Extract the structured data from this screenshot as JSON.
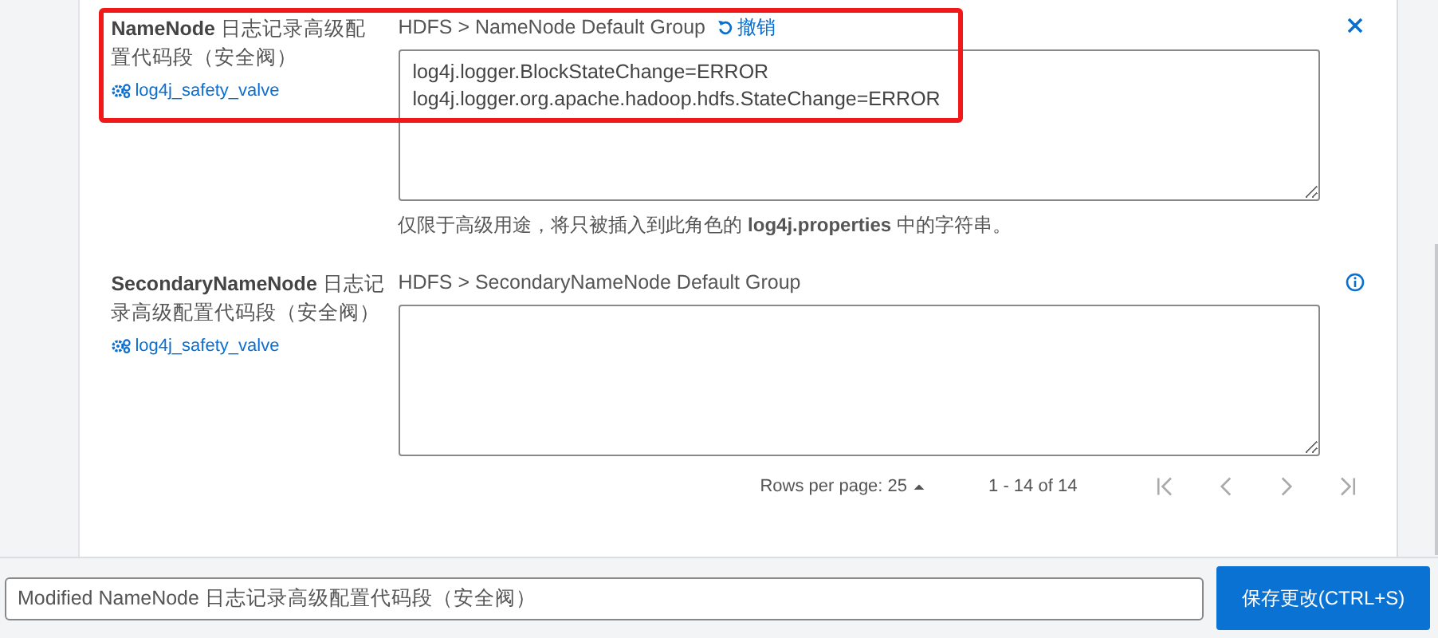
{
  "properties": [
    {
      "kind": "modified",
      "highlighted": true,
      "label": "**NameNode** 日志记录高级配置代码段（安全阀）",
      "key": "log4j_safety_valve",
      "scope": "HDFS > NameNode Default Group",
      "undo": "撤销",
      "value": "log4j.logger.BlockStateChange=ERROR\nlog4j.logger.org.apache.hadoop.hdfs.StateChange=ERROR",
      "description": "仅限于高级用途，将只被插入到此角色的 **log4j.properties** 中的字符串。"
    },
    {
      "kind": "default",
      "highlighted": false,
      "label": "**SecondaryNameNode** 日志记录高级配置代码段（安全阀）",
      "key": "log4j_safety_valve",
      "scope": "HDFS > SecondaryNameNode Default Group"
    }
  ],
  "pagination": {
    "rows_per_page": "Rows per page: 25",
    "range": "1 - 14 of 14"
  },
  "footer": {
    "message": "Modified NameNode 日志记录高级配置代码段（安全阀）",
    "save_button": "保存更改(CTRL+S)"
  }
}
